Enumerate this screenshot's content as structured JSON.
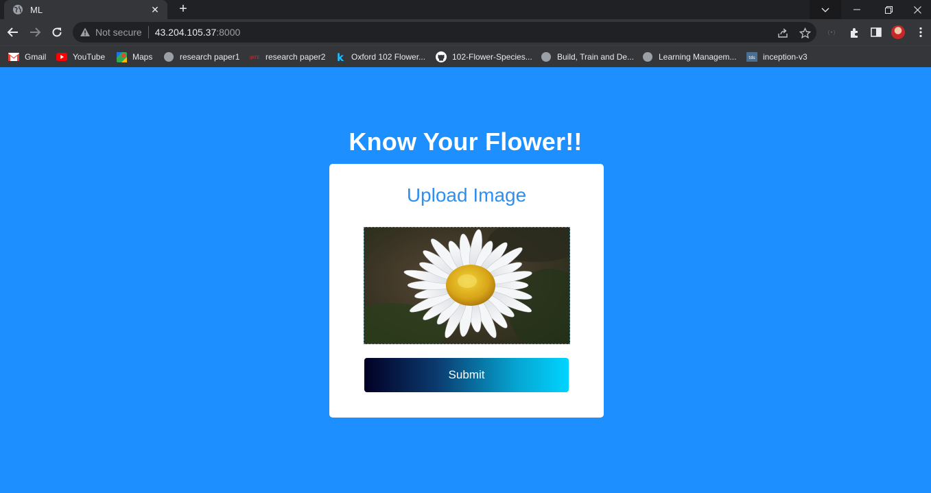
{
  "tab": {
    "title": "ML",
    "close_glyph": "✕",
    "favicon": "globe-icon"
  },
  "new_tab_glyph": "+",
  "address_bar": {
    "security_label": "Not secure",
    "host": "43.204.105.37",
    "port": ":8000"
  },
  "bookmarks": [
    {
      "label": "Gmail",
      "icon": "gmail-icon"
    },
    {
      "label": "YouTube",
      "icon": "youtube-icon"
    },
    {
      "label": "Maps",
      "icon": "maps-icon"
    },
    {
      "label": "research paper1",
      "icon": "globe-icon"
    },
    {
      "label": "research paper2",
      "icon": "paper-icon"
    },
    {
      "label": "Oxford 102 Flower...",
      "icon": "kaggle-icon"
    },
    {
      "label": "102-Flower-Species...",
      "icon": "github-icon"
    },
    {
      "label": "Build, Train and De...",
      "icon": "globe-icon"
    },
    {
      "label": "Learning Managem...",
      "icon": "globe-icon"
    },
    {
      "label": "inception-v3",
      "icon": "tds-icon"
    }
  ],
  "tds_badge": "tds",
  "page": {
    "heading": "Know Your Flower!!",
    "card_title": "Upload Image",
    "submit_label": "Submit",
    "preview_image": "daisy-flower-preview"
  },
  "colors": {
    "page_background": "#1e8fff",
    "card_title": "#2f8ff0",
    "button_gradient_start": "#020024",
    "button_gradient_end": "#00d4ff"
  }
}
